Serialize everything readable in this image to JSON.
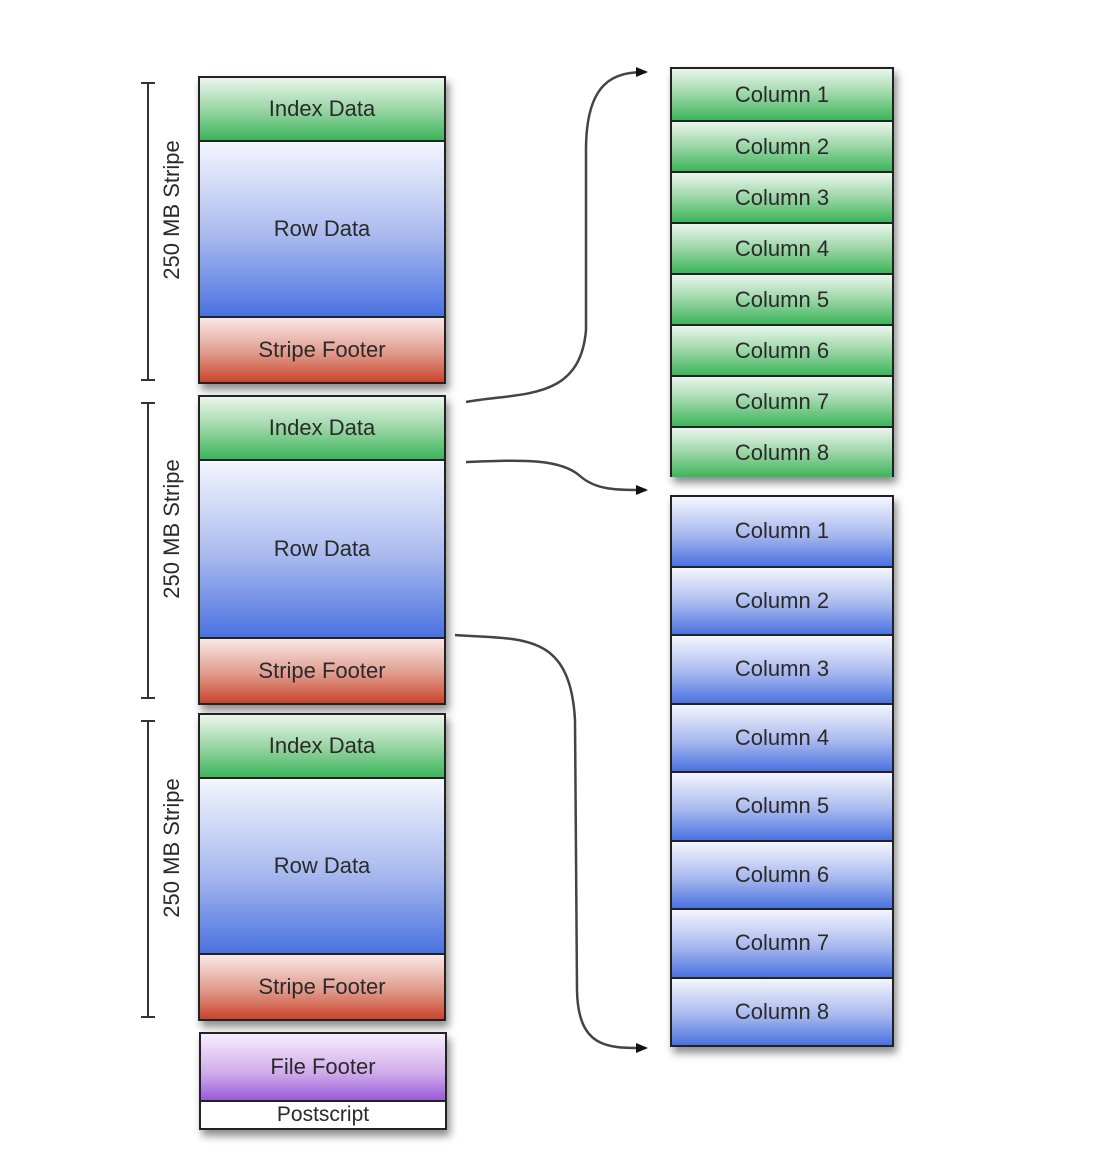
{
  "diagram": {
    "stripes": [
      {
        "size_label": "250 MB Stripe",
        "segments": [
          "Index Data",
          "Row Data",
          "Stripe Footer"
        ]
      },
      {
        "size_label": "250 MB Stripe",
        "segments": [
          "Index Data",
          "Row Data",
          "Stripe Footer"
        ]
      },
      {
        "size_label": "250 MB Stripe",
        "segments": [
          "Index Data",
          "Row Data",
          "Stripe Footer"
        ]
      }
    ],
    "file_footer": "File Footer",
    "postscript": "Postscript",
    "index_columns": [
      "Column 1",
      "Column 2",
      "Column 3",
      "Column 4",
      "Column 5",
      "Column 6",
      "Column 7",
      "Column 8"
    ],
    "row_columns": [
      "Column 1",
      "Column 2",
      "Column 3",
      "Column 4",
      "Column 5",
      "Column 6",
      "Column 7",
      "Column 8"
    ],
    "colors": {
      "index": "#3cb55a",
      "row": "#4a72e0",
      "footer": "#c9452c",
      "file_footer": "#9a5ad8"
    }
  }
}
